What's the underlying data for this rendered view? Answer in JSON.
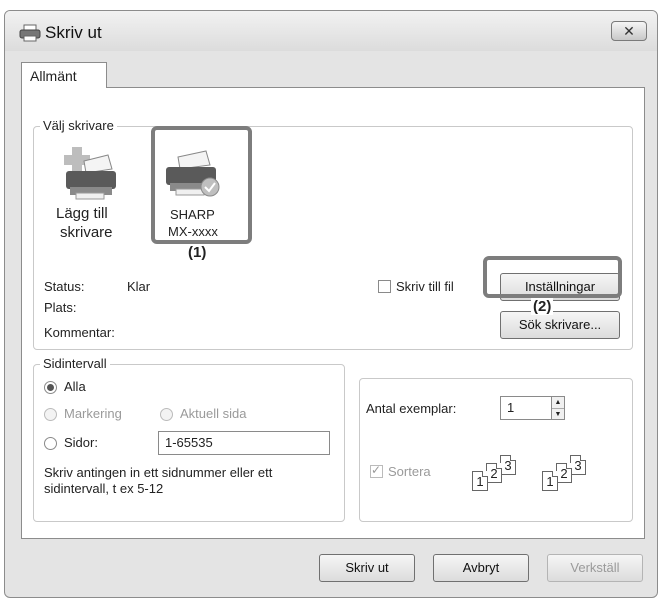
{
  "window": {
    "title": "Skriv ut",
    "close_glyph": "✕"
  },
  "tabs": [
    {
      "label": "Allmänt"
    }
  ],
  "select_printer": {
    "group_label": "Välj skrivare",
    "add_printer_line1": "Lägg till",
    "add_printer_line2": "skrivare",
    "printer_name_line1": "SHARP",
    "printer_name_line2": "MX-xxxx",
    "status_label": "Status:",
    "status_value": "Klar",
    "location_label": "Plats:",
    "comment_label": "Kommentar:",
    "print_to_file_label": "Skriv till fil",
    "preferences_button": "Inställningar",
    "find_printer_button": "Sök skrivare..."
  },
  "callouts": {
    "printer": "(1)",
    "preferences": "(2)"
  },
  "page_range": {
    "group_label": "Sidintervall",
    "all_label": "Alla",
    "selection_label": "Markering",
    "current_page_label": "Aktuell sida",
    "pages_label": "Sidor:",
    "pages_value": "1-65535",
    "help_line1": "Skriv antingen in ett sidnummer eller ett",
    "help_line2": "sidintervall, t ex 5-12"
  },
  "copies": {
    "label": "Antal exemplar:",
    "value": "1",
    "collate_label": "Sortera",
    "page_numbers": [
      "1",
      "2",
      "3"
    ]
  },
  "footer": {
    "print_button": "Skriv ut",
    "cancel_button": "Avbryt",
    "apply_button": "Verkställ"
  }
}
